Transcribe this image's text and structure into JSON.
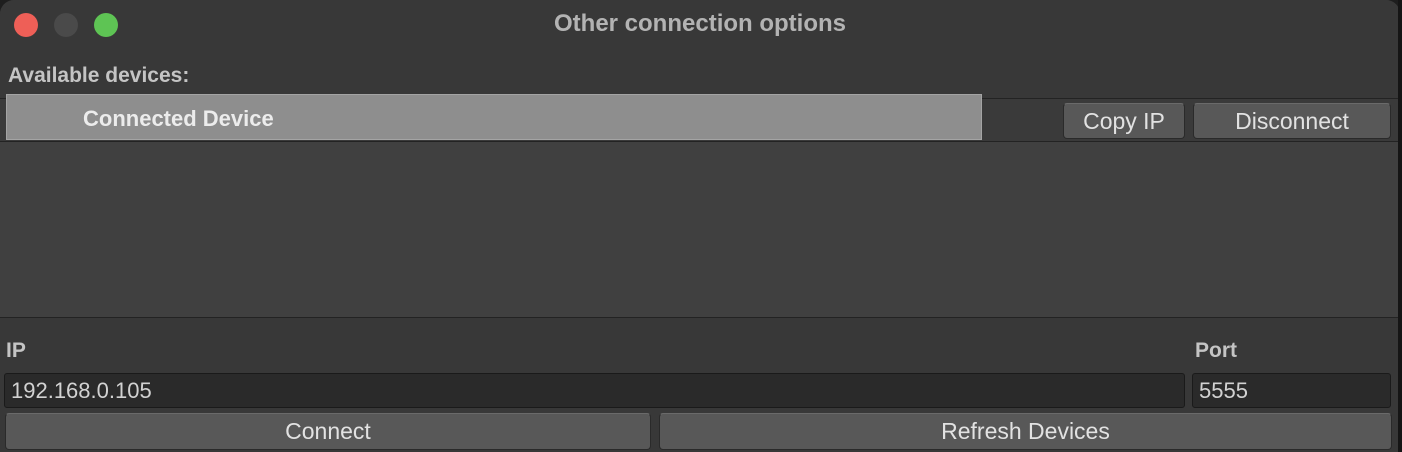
{
  "window": {
    "title": "Other connection options",
    "controls": [
      "close-button",
      "minimize-button",
      "zoom-button"
    ]
  },
  "devices": {
    "section_label": "Available devices:",
    "items": [
      {
        "name": "Connected Device",
        "copy_label": "Copy IP",
        "disconnect_label": "Disconnect"
      }
    ]
  },
  "connection": {
    "ip_label": "IP",
    "ip_value": "192.168.0.105",
    "port_label": "Port",
    "port_value": "5555",
    "connect_label": "Connect",
    "refresh_label": "Refresh Devices"
  },
  "colors": {
    "window_bg": "#383838",
    "list_bg": "#404040",
    "selected_row": "#8e8e8e",
    "button_bg": "#585858",
    "close": "#ee5f57",
    "minimize": "#4a4a4a",
    "zoom": "#5ec454"
  }
}
